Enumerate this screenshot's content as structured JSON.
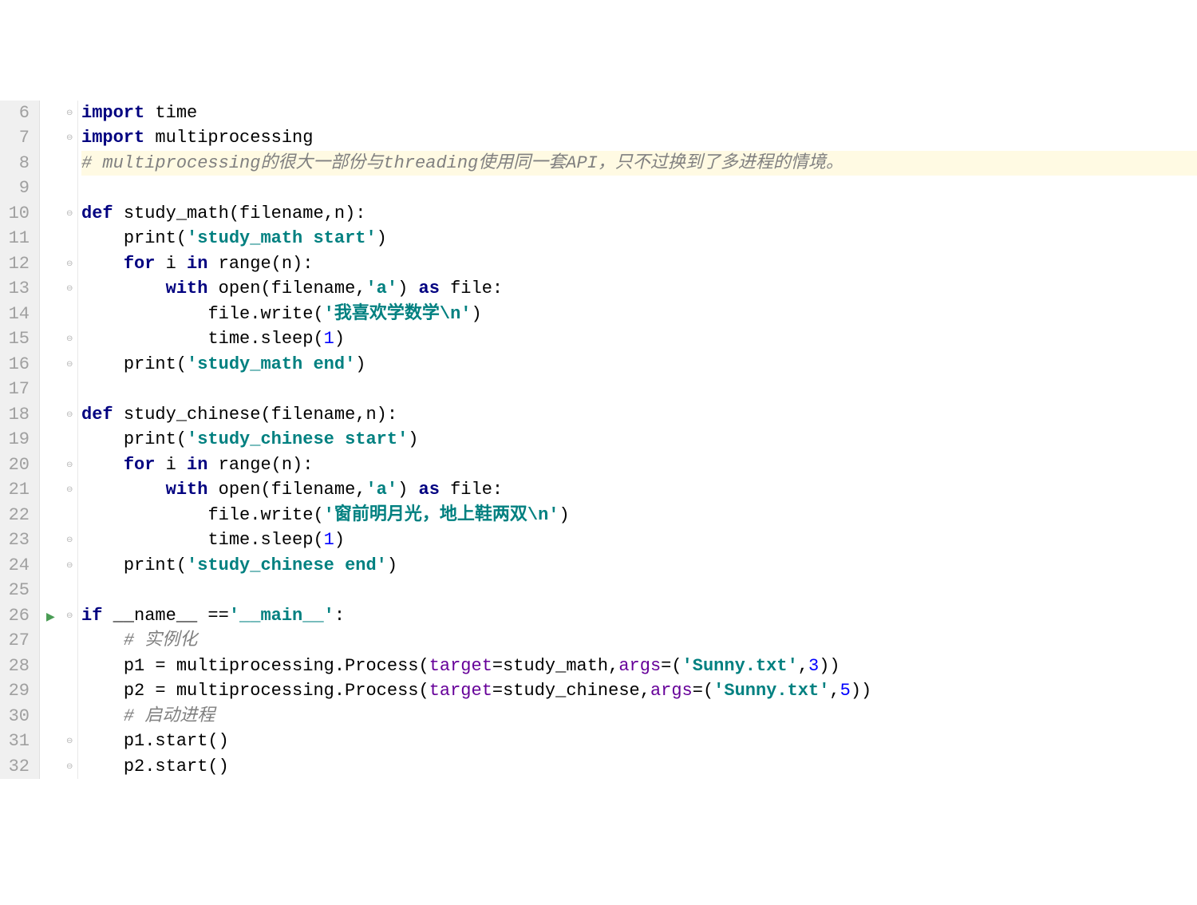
{
  "lines": [
    {
      "num": "6",
      "fold": "⊖",
      "tokens": [
        {
          "cls": "kw",
          "t": "import"
        },
        {
          "cls": "plain",
          "t": " time"
        }
      ]
    },
    {
      "num": "7",
      "fold": "⊖",
      "tokens": [
        {
          "cls": "kw",
          "t": "import"
        },
        {
          "cls": "plain",
          "t": " multiprocessing"
        }
      ]
    },
    {
      "num": "8",
      "highlight": true,
      "tokens": [
        {
          "cls": "cmt",
          "t": "# multiprocessing的很大一部份与threading使用同一套API，只不过换到了多进程的情境。"
        }
      ]
    },
    {
      "num": "9",
      "tokens": []
    },
    {
      "num": "10",
      "fold": "⊖",
      "tokens": [
        {
          "cls": "kw",
          "t": "def"
        },
        {
          "cls": "plain",
          "t": " "
        },
        {
          "cls": "fn",
          "t": "study_math"
        },
        {
          "cls": "plain",
          "t": "(filename,n):"
        }
      ]
    },
    {
      "num": "11",
      "indent": 1,
      "tokens": [
        {
          "cls": "plain",
          "t": "print("
        },
        {
          "cls": "str",
          "t": "'study_math start'"
        },
        {
          "cls": "plain",
          "t": ")"
        }
      ]
    },
    {
      "num": "12",
      "fold": "⊖",
      "indent": 1,
      "tokens": [
        {
          "cls": "kw",
          "t": "for"
        },
        {
          "cls": "plain",
          "t": " i "
        },
        {
          "cls": "kw",
          "t": "in"
        },
        {
          "cls": "plain",
          "t": " range(n):"
        }
      ]
    },
    {
      "num": "13",
      "fold": "⊖",
      "indent": 2,
      "tokens": [
        {
          "cls": "kw",
          "t": "with"
        },
        {
          "cls": "plain",
          "t": " open(filename,"
        },
        {
          "cls": "str",
          "t": "'a'"
        },
        {
          "cls": "plain",
          "t": ") "
        },
        {
          "cls": "kw",
          "t": "as"
        },
        {
          "cls": "plain",
          "t": " file:"
        }
      ]
    },
    {
      "num": "14",
      "indent": 3,
      "tokens": [
        {
          "cls": "plain",
          "t": "file.write("
        },
        {
          "cls": "str",
          "t": "'我喜欢学数学\\n'"
        },
        {
          "cls": "plain",
          "t": ")"
        }
      ]
    },
    {
      "num": "15",
      "fold": "⊖",
      "indent": 3,
      "tokens": [
        {
          "cls": "plain",
          "t": "time.sleep("
        },
        {
          "cls": "num",
          "t": "1"
        },
        {
          "cls": "plain",
          "t": ")"
        }
      ]
    },
    {
      "num": "16",
      "fold": "⊖",
      "indent": 1,
      "tokens": [
        {
          "cls": "plain",
          "t": "print("
        },
        {
          "cls": "str",
          "t": "'study_math end'"
        },
        {
          "cls": "plain",
          "t": ")"
        }
      ]
    },
    {
      "num": "17",
      "tokens": []
    },
    {
      "num": "18",
      "fold": "⊖",
      "tokens": [
        {
          "cls": "kw",
          "t": "def"
        },
        {
          "cls": "plain",
          "t": " "
        },
        {
          "cls": "fn",
          "t": "study_chinese"
        },
        {
          "cls": "plain",
          "t": "(filename,n):"
        }
      ]
    },
    {
      "num": "19",
      "indent": 1,
      "tokens": [
        {
          "cls": "plain",
          "t": "print("
        },
        {
          "cls": "str",
          "t": "'study_chinese start'"
        },
        {
          "cls": "plain",
          "t": ")"
        }
      ]
    },
    {
      "num": "20",
      "fold": "⊖",
      "indent": 1,
      "tokens": [
        {
          "cls": "kw",
          "t": "for"
        },
        {
          "cls": "plain",
          "t": " i "
        },
        {
          "cls": "kw",
          "t": "in"
        },
        {
          "cls": "plain",
          "t": " range(n):"
        }
      ]
    },
    {
      "num": "21",
      "fold": "⊖",
      "indent": 2,
      "tokens": [
        {
          "cls": "kw",
          "t": "with"
        },
        {
          "cls": "plain",
          "t": " open(filename,"
        },
        {
          "cls": "str",
          "t": "'a'"
        },
        {
          "cls": "plain",
          "t": ") "
        },
        {
          "cls": "kw",
          "t": "as"
        },
        {
          "cls": "plain",
          "t": " file:"
        }
      ]
    },
    {
      "num": "22",
      "indent": 3,
      "tokens": [
        {
          "cls": "plain",
          "t": "file.write("
        },
        {
          "cls": "str",
          "t": "'窗前明月光，地上鞋两双\\n'"
        },
        {
          "cls": "plain",
          "t": ")"
        }
      ]
    },
    {
      "num": "23",
      "fold": "⊖",
      "indent": 3,
      "tokens": [
        {
          "cls": "plain",
          "t": "time.sleep("
        },
        {
          "cls": "num",
          "t": "1"
        },
        {
          "cls": "plain",
          "t": ")"
        }
      ]
    },
    {
      "num": "24",
      "fold": "⊖",
      "indent": 1,
      "tokens": [
        {
          "cls": "plain",
          "t": "print("
        },
        {
          "cls": "str",
          "t": "'study_chinese end'"
        },
        {
          "cls": "plain",
          "t": ")"
        }
      ]
    },
    {
      "num": "25",
      "tokens": []
    },
    {
      "num": "26",
      "fold": "⊖",
      "run": true,
      "tokens": [
        {
          "cls": "kw",
          "t": "if"
        },
        {
          "cls": "plain",
          "t": " __name__ =="
        },
        {
          "cls": "str",
          "t": "'__main__'"
        },
        {
          "cls": "plain",
          "t": ":"
        }
      ]
    },
    {
      "num": "27",
      "indent": 1,
      "tokens": [
        {
          "cls": "cmt",
          "t": "# 实例化"
        }
      ]
    },
    {
      "num": "28",
      "indent": 1,
      "tokens": [
        {
          "cls": "plain",
          "t": "p1 = multiprocessing.Process("
        },
        {
          "cls": "kwarg",
          "t": "target"
        },
        {
          "cls": "plain",
          "t": "=study_math,"
        },
        {
          "cls": "kwarg",
          "t": "args"
        },
        {
          "cls": "plain",
          "t": "=("
        },
        {
          "cls": "str",
          "t": "'Sunny.txt'"
        },
        {
          "cls": "plain",
          "t": ","
        },
        {
          "cls": "num",
          "t": "3"
        },
        {
          "cls": "plain",
          "t": "))"
        }
      ]
    },
    {
      "num": "29",
      "indent": 1,
      "tokens": [
        {
          "cls": "plain",
          "t": "p2 = multiprocessing.Process("
        },
        {
          "cls": "kwarg",
          "t": "target"
        },
        {
          "cls": "plain",
          "t": "=study_chinese,"
        },
        {
          "cls": "kwarg",
          "t": "args"
        },
        {
          "cls": "plain",
          "t": "=("
        },
        {
          "cls": "str",
          "t": "'Sunny.txt'"
        },
        {
          "cls": "plain",
          "t": ","
        },
        {
          "cls": "num",
          "t": "5"
        },
        {
          "cls": "plain",
          "t": "))"
        }
      ]
    },
    {
      "num": "30",
      "indent": 1,
      "tokens": [
        {
          "cls": "cmt",
          "t": "# 启动进程"
        }
      ]
    },
    {
      "num": "31",
      "fold": "⊖",
      "indent": 1,
      "tokens": [
        {
          "cls": "plain",
          "t": "p1.start()"
        }
      ]
    },
    {
      "num": "32",
      "fold": "⊖",
      "indent": 1,
      "tokens": [
        {
          "cls": "plain",
          "t": "p2.start()"
        }
      ]
    }
  ]
}
